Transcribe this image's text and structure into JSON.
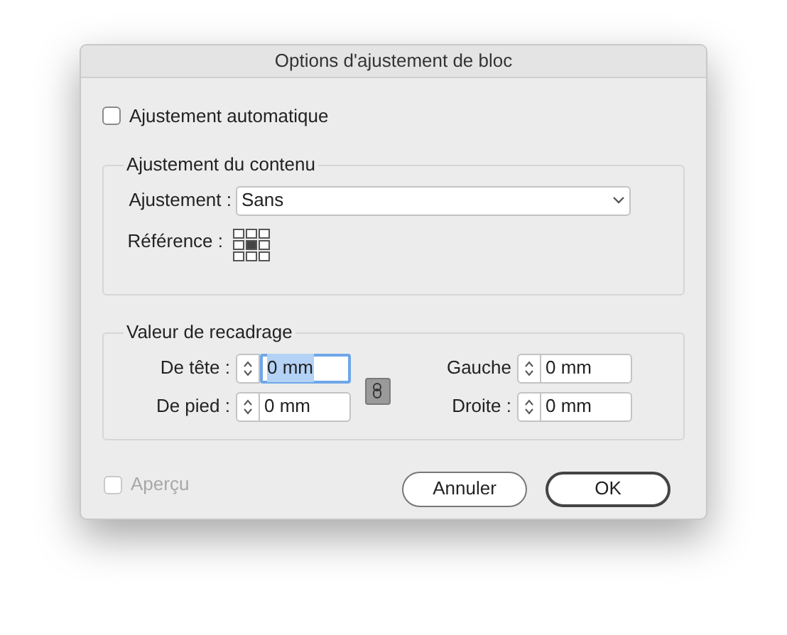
{
  "window": {
    "title": "Options d'ajustement de bloc"
  },
  "auto_fit": {
    "label": "Ajustement automatique",
    "checked": false
  },
  "content_fit": {
    "title": "Ajustement du contenu",
    "fitting_label": "Ajustement :",
    "fitting_value": "Sans",
    "reference_label": "Référence :",
    "reference_points": [
      {
        "selected": false
      },
      {
        "selected": false
      },
      {
        "selected": false
      },
      {
        "selected": false
      },
      {
        "selected": true
      },
      {
        "selected": false
      },
      {
        "selected": false
      },
      {
        "selected": false
      },
      {
        "selected": false
      }
    ]
  },
  "crop": {
    "title": "Valeur de recadrage",
    "linked": true,
    "fields": [
      {
        "label": "De tête :",
        "value": "0 mm",
        "focused": true
      },
      {
        "label": "Gauche",
        "value": "0 mm",
        "focused": false
      },
      {
        "label": "De pied :",
        "value": "0 mm",
        "focused": false
      },
      {
        "label": "Droite :",
        "value": "0 mm",
        "focused": false
      }
    ]
  },
  "preview": {
    "label": "Aperçu",
    "checked": false,
    "disabled": true
  },
  "buttons": [
    {
      "label": "Annuler",
      "default": false
    },
    {
      "label": "OK",
      "default": true
    }
  ]
}
